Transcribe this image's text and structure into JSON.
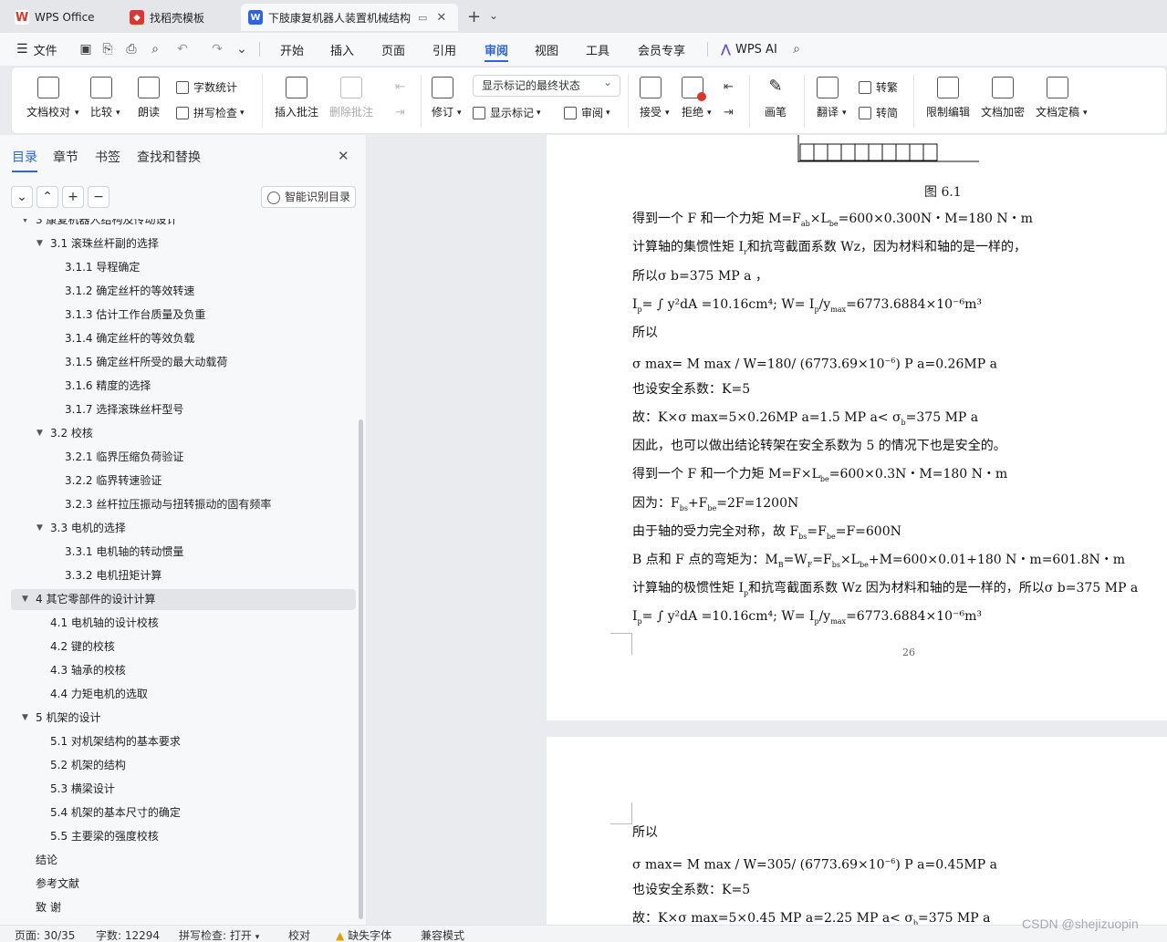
{
  "tabs": [
    {
      "label": "WPS Office"
    },
    {
      "label": "找稻壳模板"
    },
    {
      "label": "下肢康复机器人装置机械结构"
    }
  ],
  "menu": {
    "file": "文件",
    "items": [
      "开始",
      "插入",
      "页面",
      "引用",
      "审阅",
      "视图",
      "工具",
      "会员专享"
    ],
    "active": "审阅",
    "wps_ai": "WPS AI"
  },
  "ribbon": {
    "proofread": "文档校对",
    "compare": "比较",
    "read_aloud": "朗读",
    "word_count": "字数统计",
    "spell_check": "拼写检查",
    "insert_comment": "插入批注",
    "delete_comment": "删除批注",
    "revise": "修订",
    "markup_state": "显示标记的最终状态",
    "show_markup": "显示标记",
    "review": "审阅",
    "accept": "接受",
    "reject": "拒绝",
    "pen": "画笔",
    "translate": "翻译",
    "to_traditional": "转繁",
    "to_simplified": "转简",
    "restrict_edit": "限制编辑",
    "encrypt": "文档加密",
    "finalize": "文档定稿"
  },
  "nav": {
    "tabs": [
      "目录",
      "章节",
      "书签",
      "查找和替换"
    ],
    "active": "目录",
    "smart_button": "智能识别目录"
  },
  "toc": [
    {
      "text": "3   康复机器人结构及传动设计",
      "level": 1,
      "arrow": true
    },
    {
      "text": "3.1  滚珠丝杆副的选择",
      "level": 2,
      "arrow": true
    },
    {
      "text": "3.1.1 导程确定",
      "level": 3
    },
    {
      "text": "3.1.2 确定丝杆的等效转速",
      "level": 3
    },
    {
      "text": "3.1.3 估计工作台质量及负重",
      "level": 3
    },
    {
      "text": "3.1.4 确定丝杆的等效负载",
      "level": 3
    },
    {
      "text": "3.1.5 确定丝杆所受的最大动载荷",
      "level": 3
    },
    {
      "text": "3.1.6 精度的选择",
      "level": 3
    },
    {
      "text": "3.1.7 选择滚珠丝杆型号",
      "level": 3
    },
    {
      "text": "3.2 校核",
      "level": 2,
      "arrow": true
    },
    {
      "text": "3.2.1  临界压缩负荷验证",
      "level": 3
    },
    {
      "text": "3.2.2 临界转速验证",
      "level": 3
    },
    {
      "text": "3.2.3 丝杆拉压振动与扭转振动的固有频率",
      "level": 3
    },
    {
      "text": "3.3 电机的选择",
      "level": 2,
      "arrow": true
    },
    {
      "text": "3.3.1 电机轴的转动惯量",
      "level": 3
    },
    {
      "text": "3.3.2 电机扭矩计算",
      "level": 3
    },
    {
      "text": "4   其它零部件的设计计算",
      "level": 1,
      "arrow": true,
      "selected": true
    },
    {
      "text": "4.1 电机轴的设计校核",
      "level": 2
    },
    {
      "text": "4.2 键的校核",
      "level": 2
    },
    {
      "text": "4.3 轴承的校核",
      "level": 2
    },
    {
      "text": "4.4 力矩电机的选取",
      "level": 2
    },
    {
      "text": "5  机架的设计",
      "level": 1,
      "arrow": true
    },
    {
      "text": "5.1 对机架结构的基本要求",
      "level": 2
    },
    {
      "text": "5.2 机架的结构",
      "level": 2
    },
    {
      "text": "5.3 横梁设计",
      "level": 2
    },
    {
      "text": "5.4 机架的基本尺寸的确定",
      "level": 2
    },
    {
      "text": "5.5 主要梁的强度校核",
      "level": 2
    },
    {
      "text": "结论",
      "level": 1
    },
    {
      "text": "参考文献",
      "level": 1
    },
    {
      "text": "致 谢",
      "level": 1
    }
  ],
  "doc": {
    "fig_caption": "图 6.1",
    "page_number": "26",
    "p1": [
      "得到一个 F 和一个力矩 M=F",
      "计算轴的集惯性矩 I",
      "所以σ  b=375  MP  a ，",
      "I",
      "所以",
      "σ  max= M max / W=180/ (6773.69×10",
      "也设安全系数：K=5",
      "故：K×σ  max=5×0.26MP a=1.5 MP a< σ",
      "因此，也可以做出结论转架在安全系数为 5 的情况下也是安全的。",
      "得到一个 F 和一个力矩 M=F×L",
      "因为：F",
      "由于轴的受力完全对称，故 F",
      "B 点和 F 点的弯矩为：M",
      "计算轴的极惯性矩 I",
      "I"
    ],
    "p1_tail": [
      "×L",
      "=600×0.300N・M=180 N・m",
      "和抗弯截面系数 Wz，因为材料和轴的是一样的，",
      "= ∫ y²dA =10.16cm⁴; W= I",
      "/y",
      "max",
      "=6773.6884×10⁻⁶m³",
      ") P a=0.26MP a",
      "=375 MP a",
      "=600×0.3N・M=180 N・m",
      "+F",
      "=2F=1200N",
      "=F",
      "=F=600N",
      "=W",
      "=F",
      "×L",
      "+M=600×0.01+180 N・m=601.8N・m",
      "和抗弯截面系数 Wz 因为材料和轴的是一样的，所以σ b=375 MP a"
    ],
    "p2": [
      "所以",
      "σ  max= M max / W=305/ (6773.69×10",
      ") P a=0.45MP a",
      "也设安全系数：K=5",
      "故：K×σ  max=5×0.45 MP a=2.25 MP a< σ",
      "=375 MP a"
    ],
    "sub": {
      "ab": "ab",
      "be": "be",
      "bs": "bs",
      "be2": "be",
      "p": "p",
      "r": "r",
      "s": "s",
      "B": "B",
      "F": "F",
      "b": "b",
      "neg6": "−6",
      "neg6b": "⁻⁶"
    }
  },
  "status": {
    "page": "页面: 30/35",
    "words": "字数: 12294",
    "spell": "拼写检查: 打开",
    "proof": "校对",
    "missing_font": "缺失字体",
    "compat": "兼容模式"
  },
  "watermark": "CSDN @shejizuopin"
}
